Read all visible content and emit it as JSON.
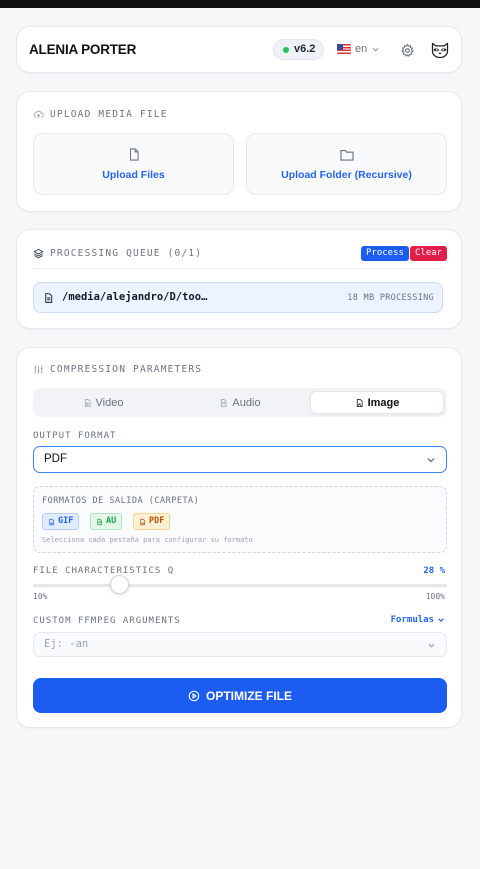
{
  "header": {
    "brand": "ALENIA PORTER",
    "version": "v6.2",
    "status_color": "#22c55e",
    "language": "en",
    "icons": [
      "flag-us-icon",
      "chevron-down-icon",
      "gear-icon",
      "raccoon-avatar-icon"
    ]
  },
  "upload": {
    "title": "UPLOAD MEDIA FILE",
    "files_label": "Upload Files",
    "folder_label": "Upload Folder (Recursive)"
  },
  "queue": {
    "title": "PROCESSING QUEUE (0/1)",
    "process_label": "Process",
    "clear_label": "Clear",
    "process_color": "#1d5cf0",
    "clear_color": "#e11d48",
    "item": {
      "path": "/media/alejandro/D/too…",
      "size": "18 MB",
      "status": "PROCESSING"
    }
  },
  "params": {
    "title": "COMPRESSION PARAMETERS",
    "tabs": [
      {
        "label": "Video",
        "active": false
      },
      {
        "label": "Audio",
        "active": false
      },
      {
        "label": "Image",
        "active": true
      }
    ],
    "output_format_label": "OUTPUT FORMAT",
    "output_format_value": "PDF",
    "formats_title": "FORMATOS DE SALIDA (CARPETA)",
    "formats": [
      {
        "label": "GIF",
        "color": "#2563eb"
      },
      {
        "label": "AU",
        "color": "#16a34a"
      },
      {
        "label": "PDF",
        "color": "#b45309"
      }
    ],
    "formats_hint": "Selecciona cada pestaña para configurar su formato",
    "quality_label": "FILE CHARACTERISTICS Q",
    "quality_value_text": "28 %",
    "quality_value": 0.21,
    "quality_min": "10%",
    "quality_max": "100%",
    "args_label": "CUSTOM FFMPEG ARGUMENTS",
    "formulas_label": "Formulas",
    "args_placeholder": "Ej: -an",
    "optimize_label": "OPTIMIZE FILE",
    "accent": "#1d5cf0"
  }
}
